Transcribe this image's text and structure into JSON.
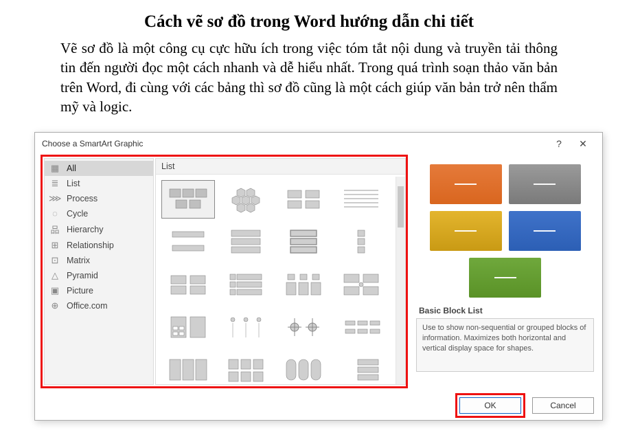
{
  "article": {
    "title": "Cách vẽ sơ đồ trong Word hướng dẫn chi tiết",
    "paragraph": "Vẽ sơ đồ là một công cụ cực hữu ích trong việc tóm tắt nội dung và truyền tải thông tin đến người đọc một cách nhanh và dễ hiểu nhất. Trong quá trình soạn thảo văn bản trên Word, đi cùng với các bảng thì sơ đồ cũng là một cách giúp văn bản trở nên thẩm mỹ và logic."
  },
  "dialog": {
    "title": "Choose a SmartArt Graphic",
    "help_label": "?",
    "close_label": "✕",
    "categories": [
      {
        "icon": "▦",
        "label": "All",
        "selected": true
      },
      {
        "icon": "≣",
        "label": "List"
      },
      {
        "icon": "⋙",
        "label": "Process"
      },
      {
        "icon": "◌",
        "label": "Cycle"
      },
      {
        "icon": "品",
        "label": "Hierarchy"
      },
      {
        "icon": "⊞",
        "label": "Relationship"
      },
      {
        "icon": "⊡",
        "label": "Matrix"
      },
      {
        "icon": "△",
        "label": "Pyramid"
      },
      {
        "icon": "▣",
        "label": "Picture"
      },
      {
        "icon": "⊕",
        "label": "Office.com"
      }
    ],
    "gallery_header": "List",
    "preview": {
      "title": "Basic Block List",
      "description": "Use to show non-sequential or grouped blocks of information. Maximizes both horizontal and vertical display space for shapes."
    },
    "buttons": {
      "ok": "OK",
      "cancel": "Cancel"
    }
  }
}
